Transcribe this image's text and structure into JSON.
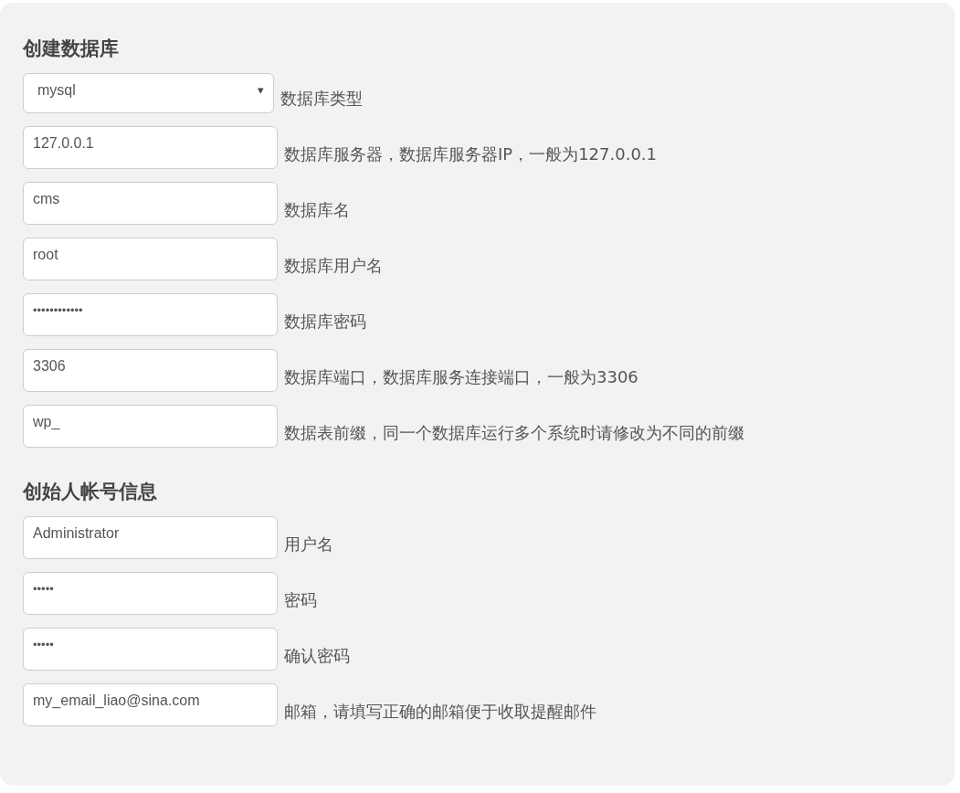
{
  "sections": [
    {
      "title": "创建数据库",
      "fields": [
        {
          "kind": "select",
          "value": "mysql",
          "caret": "▾",
          "label": "数据库类型"
        },
        {
          "kind": "text",
          "value": "127.0.0.1",
          "label": "数据库服务器，数据库服务器IP，一般为127.0.0.1"
        },
        {
          "kind": "text",
          "value": "cms",
          "label": "数据库名"
        },
        {
          "kind": "text",
          "value": "root",
          "label": "数据库用户名"
        },
        {
          "kind": "password",
          "value": "••••••••••••",
          "label": "数据库密码"
        },
        {
          "kind": "text",
          "value": "3306",
          "label": "数据库端口，数据库服务连接端口，一般为3306"
        },
        {
          "kind": "text",
          "value": "wp_",
          "label": "数据表前缀，同一个数据库运行多个系统时请修改为不同的前缀"
        }
      ]
    },
    {
      "title": "创始人帐号信息",
      "fields": [
        {
          "kind": "text",
          "value": "Administrator",
          "label": "用户名"
        },
        {
          "kind": "password",
          "value": "•••••",
          "label": "密码"
        },
        {
          "kind": "password",
          "value": "•••••",
          "label": "确认密码"
        },
        {
          "kind": "text",
          "value": "my_email_liao@sina.com",
          "label": "邮箱，请填写正确的邮箱便于收取提醒邮件"
        }
      ]
    }
  ]
}
